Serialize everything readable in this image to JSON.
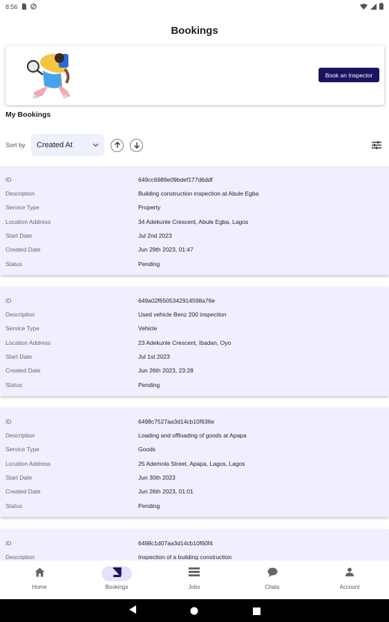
{
  "status_bar": {
    "time": "8:56"
  },
  "app": {
    "title": "Bookings"
  },
  "banner": {
    "button_label": "Book an Inspector"
  },
  "section": {
    "title": "My Bookings"
  },
  "sort": {
    "label": "Sort by",
    "selected": "Created At"
  },
  "field_labels": [
    "ID",
    "Description",
    "Service Type",
    "Location Address",
    "Start Date",
    "Created Date",
    "Status"
  ],
  "bookings": [
    {
      "id": "649cc6989e09bdef177d6ddf",
      "description": "Building construction inspection at Abule Egba",
      "service_type": "Property",
      "location": "34 Adekunle Crescent, Abule Egba, Lagos",
      "start_date": "Jul 2nd 2023",
      "created_date": "Jun 29th 2023, 01:47",
      "status": "Pending"
    },
    {
      "id": "649a02f6505342914598a76e",
      "description": "Used vehicle Benz 200 inspection",
      "service_type": "Vehicle",
      "location": "23 Adekunle Crescent, Ibadan, Oyo",
      "start_date": "Jul 1st 2023",
      "created_date": "Jun 26th 2023, 23:28",
      "status": "Pending"
    },
    {
      "id": "6498c7527aa3d14cb10f636e",
      "description": "Loading and offloading of goods at Apapa",
      "service_type": "Goods",
      "location": "25 Ademola Street, Apapa, Lagos, Lagos",
      "start_date": "Jun 30th 2023",
      "created_date": "Jun 26th 2023, 01:01",
      "status": "Pending"
    },
    {
      "id": "6498c1d07aa3d14cb10f60f4",
      "description": "Inspection of a building construction",
      "service_type": "",
      "location": "",
      "start_date": "",
      "created_date": "",
      "status": ""
    }
  ],
  "nav": {
    "home": "Home",
    "bookings": "Bookings",
    "jobs": "Jobs",
    "chats": "Chats",
    "account": "Account"
  },
  "colors": {
    "primary": "#1a1360",
    "card_bg": "#efefff",
    "active_nav": "#e6e0f8"
  }
}
